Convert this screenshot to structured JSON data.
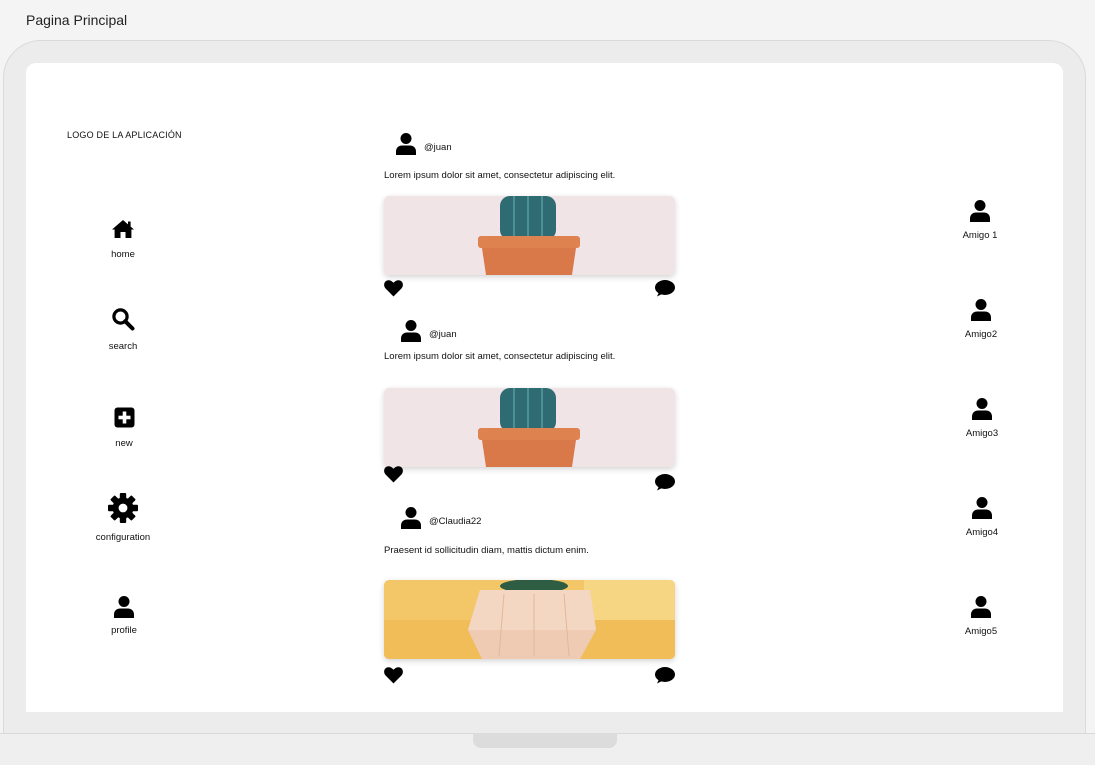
{
  "window": {
    "title": "Pagina Principal"
  },
  "sidebar": {
    "logo": "LOGO DE LA APLICACIÓN",
    "items": [
      {
        "label": "home",
        "icon": "home-icon"
      },
      {
        "label": "search",
        "icon": "search-icon"
      },
      {
        "label": "new",
        "icon": "plus-square-icon"
      },
      {
        "label": "configuration",
        "icon": "gear-icon"
      },
      {
        "label": "profile",
        "icon": "user-icon"
      }
    ]
  },
  "feed": {
    "posts": [
      {
        "user": "@juan",
        "text": "Lorem ipsum dolor sit amet, consectetur adipiscing elit.",
        "image": "cactus-pot-pink"
      },
      {
        "user": "@juan",
        "text": "Lorem ipsum dolor sit amet, consectetur adipiscing elit.",
        "image": "cactus-pot-pink"
      },
      {
        "user": "@Claudia22",
        "text": "Praesent id sollicitudin diam, mattis dictum enim.",
        "image": "succulent-wood-pot-yellow"
      }
    ]
  },
  "friends": [
    {
      "label": "Amigo 1"
    },
    {
      "label": "Amigo2"
    },
    {
      "label": "Amigo3"
    },
    {
      "label": "Amigo4"
    },
    {
      "label": "Amigo5"
    }
  ],
  "colors": {
    "screen": "#ffffff",
    "frame": "#ececec",
    "icon": "#000000",
    "pot": "#d9794a",
    "cactus": "#2f6b73",
    "pink_bg": "#f1e4e6",
    "yellow_bg": "#f3c667"
  }
}
